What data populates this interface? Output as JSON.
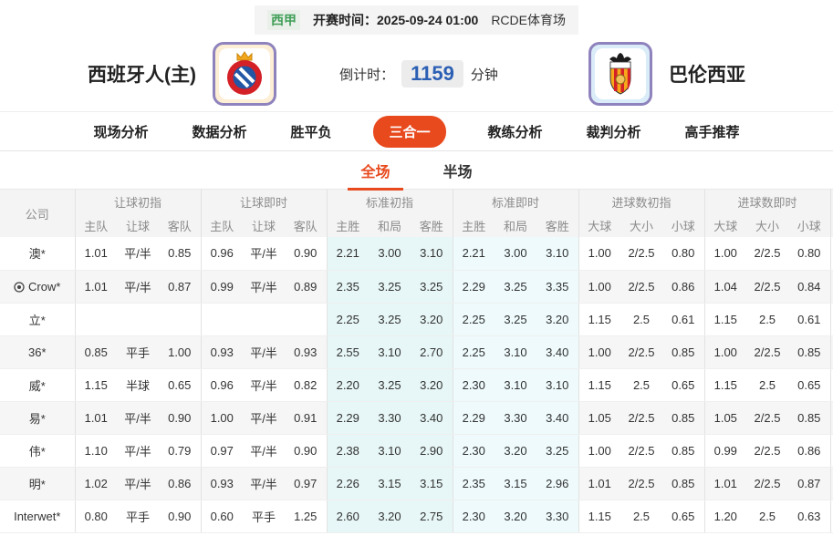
{
  "colors": {
    "accent": "#e8491d",
    "live_blue": "#2a66b7",
    "league_green": "#3f9e57",
    "countdown_blue": "#2b5fb4",
    "espanyol_red": "#d42027",
    "espanyol_blue": "#2257a5",
    "valencia_yellow": "#f7a81b",
    "valencia_red": "#d42027"
  },
  "header": {
    "league": "西甲",
    "kickoff_label": "开赛时间：",
    "kickoff_time": "2025-09-24 01:00",
    "venue": "RCDE体育场",
    "home_team": "西班牙人(主)",
    "away_team": "巴伦西亚",
    "countdown_label": "倒计时：",
    "countdown_value": "1159",
    "countdown_unit": "分钟"
  },
  "nav_tabs": [
    {
      "label": "现场分析",
      "active": false
    },
    {
      "label": "数据分析",
      "active": false
    },
    {
      "label": "胜平负",
      "active": false
    },
    {
      "label": "三合一",
      "active": true
    },
    {
      "label": "教练分析",
      "active": false
    },
    {
      "label": "裁判分析",
      "active": false
    },
    {
      "label": "高手推荐",
      "active": false
    }
  ],
  "sub_tabs": [
    {
      "label": "全场",
      "active": true
    },
    {
      "label": "半场",
      "active": false
    }
  ],
  "table": {
    "company_header": "公司",
    "groups": [
      {
        "label": "让球初指",
        "cols": [
          "主队",
          "让球",
          "客队"
        ],
        "style": "initial"
      },
      {
        "label": "让球即时",
        "cols": [
          "主队",
          "让球",
          "客队"
        ],
        "style": "live"
      },
      {
        "label": "标准初指",
        "cols": [
          "主胜",
          "和局",
          "客胜"
        ],
        "style": "tint-initial"
      },
      {
        "label": "标准即时",
        "cols": [
          "主胜",
          "和局",
          "客胜"
        ],
        "style": "tint-live"
      },
      {
        "label": "进球数初指",
        "cols": [
          "大球",
          "大小",
          "小球"
        ],
        "style": "initial"
      },
      {
        "label": "进球数即时",
        "cols": [
          "大球",
          "大小",
          "小球"
        ],
        "style": "live"
      }
    ],
    "rows": [
      {
        "company": "澳*",
        "icon": false,
        "cells": [
          "1.01",
          "平/半",
          "0.85",
          "0.96",
          "平/半",
          "0.90",
          "2.21",
          "3.00",
          "3.10",
          "2.21",
          "3.00",
          "3.10",
          "1.00",
          "2/2.5",
          "0.80",
          "1.00",
          "2/2.5",
          "0.80"
        ]
      },
      {
        "company": "Crow*",
        "icon": true,
        "cells": [
          "1.01",
          "平/半",
          "0.87",
          "0.99",
          "平/半",
          "0.89",
          "2.35",
          "3.25",
          "3.25",
          "2.29",
          "3.25",
          "3.35",
          "1.00",
          "2/2.5",
          "0.86",
          "1.04",
          "2/2.5",
          "0.84"
        ]
      },
      {
        "company": "立*",
        "icon": false,
        "cells": [
          "",
          "",
          "",
          "",
          "",
          "",
          "2.25",
          "3.25",
          "3.20",
          "2.25",
          "3.25",
          "3.20",
          "1.15",
          "2.5",
          "0.61",
          "1.15",
          "2.5",
          "0.61"
        ]
      },
      {
        "company": "36*",
        "icon": false,
        "cells": [
          "0.85",
          "平手",
          "1.00",
          "0.93",
          "平/半",
          "0.93",
          "2.55",
          "3.10",
          "2.70",
          "2.25",
          "3.10",
          "3.40",
          "1.00",
          "2/2.5",
          "0.85",
          "1.00",
          "2/2.5",
          "0.85"
        ]
      },
      {
        "company": "威*",
        "icon": false,
        "cells": [
          "1.15",
          "半球",
          "0.65",
          "0.96",
          "平/半",
          "0.82",
          "2.20",
          "3.25",
          "3.20",
          "2.30",
          "3.10",
          "3.10",
          "1.15",
          "2.5",
          "0.65",
          "1.15",
          "2.5",
          "0.65"
        ]
      },
      {
        "company": "易*",
        "icon": false,
        "cells": [
          "1.01",
          "平/半",
          "0.90",
          "1.00",
          "平/半",
          "0.91",
          "2.29",
          "3.30",
          "3.40",
          "2.29",
          "3.30",
          "3.40",
          "1.05",
          "2/2.5",
          "0.85",
          "1.05",
          "2/2.5",
          "0.85"
        ]
      },
      {
        "company": "伟*",
        "icon": false,
        "cells": [
          "1.10",
          "平/半",
          "0.79",
          "0.97",
          "平/半",
          "0.90",
          "2.38",
          "3.10",
          "2.90",
          "2.30",
          "3.20",
          "3.25",
          "1.00",
          "2/2.5",
          "0.85",
          "0.99",
          "2/2.5",
          "0.86"
        ]
      },
      {
        "company": "明*",
        "icon": false,
        "cells": [
          "1.02",
          "平/半",
          "0.86",
          "0.93",
          "平/半",
          "0.97",
          "2.26",
          "3.15",
          "3.15",
          "2.35",
          "3.15",
          "2.96",
          "1.01",
          "2/2.5",
          "0.85",
          "1.01",
          "2/2.5",
          "0.87"
        ]
      },
      {
        "company": "Interwet*",
        "icon": false,
        "cells": [
          "0.80",
          "平手",
          "0.90",
          "0.60",
          "平手",
          "1.25",
          "2.60",
          "3.20",
          "2.75",
          "2.30",
          "3.20",
          "3.30",
          "1.15",
          "2.5",
          "0.65",
          "1.20",
          "2.5",
          "0.63"
        ]
      }
    ]
  }
}
